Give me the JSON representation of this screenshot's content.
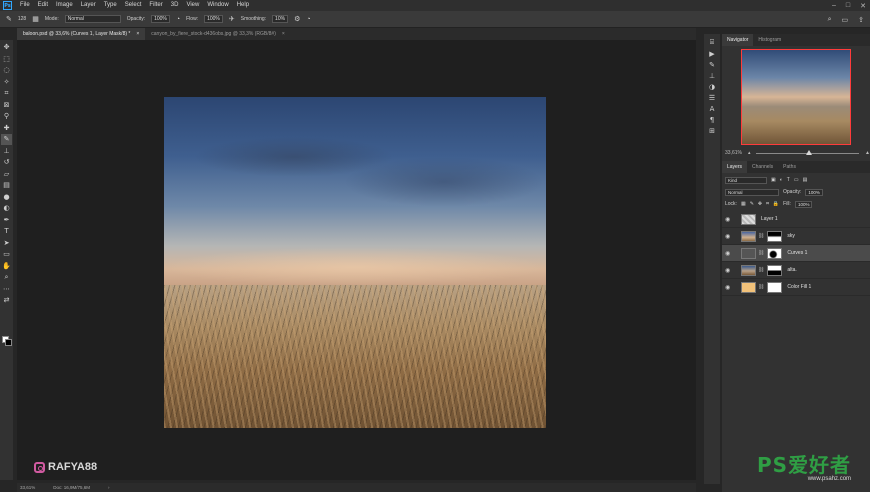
{
  "menubar": {
    "logo": "Ps",
    "items": [
      "File",
      "Edit",
      "Image",
      "Layer",
      "Type",
      "Select",
      "Filter",
      "3D",
      "View",
      "Window",
      "Help"
    ]
  },
  "options": {
    "brush_size": "128",
    "mode_label": "Mode:",
    "mode_value": "Normal",
    "opacity_label": "Opacity:",
    "opacity_value": "100%",
    "flow_label": "Flow:",
    "flow_value": "100%",
    "smoothing_label": "Smoothing:",
    "smoothing_value": "10%"
  },
  "tabs": [
    {
      "label": "baloon.psd @ 33,6% (Curves 1, Layer Mask/8) *",
      "close": "×"
    },
    {
      "label": "canyon_by_fiere_stock-d436obs.jpg @ 33,3% (RGB/8#)",
      "close": "×"
    }
  ],
  "status": {
    "zoom": "33,61%",
    "doc": "Doc: 16,9M/75,6M"
  },
  "watermark": {
    "handle": "RAFYA88"
  },
  "navigator": {
    "tabs": [
      "Navigator",
      "Histogram"
    ],
    "zoom": "33,61%"
  },
  "layers_panel": {
    "tabs": [
      "Layers",
      "Channels",
      "Paths"
    ],
    "kind_label": "Kind",
    "blend_mode": "Normal",
    "opacity_label": "Opacity:",
    "opacity_value": "100%",
    "lock_label": "Lock:",
    "fill_label": "Fill:",
    "fill_value": "100%",
    "layers": [
      {
        "name": "Layer 1"
      },
      {
        "name": "sky"
      },
      {
        "name": "Curves 1"
      },
      {
        "name": "alta."
      },
      {
        "name": "Color Fill 1"
      }
    ]
  },
  "corner_logo": {
    "main": "PS爱好者",
    "url": "www.psahz.com"
  }
}
